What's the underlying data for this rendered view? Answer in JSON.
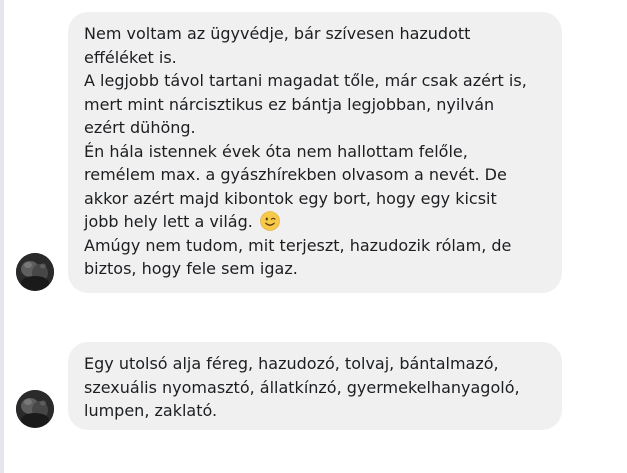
{
  "messages": [
    {
      "lines": [
        "Nem voltam az ügyvédje, bár szívesen hazudott",
        "efféléket is.",
        "A legjobb távol tartani magadat tőle, már csak azért is,",
        "mert mint nárcisztikus ez bántja legjobban, nyilván",
        "ezért dühöng.",
        "Én hála istennek évek óta nem hallottam felőle,",
        "remélem max. a gyászhírekben olvasom a nevét. De",
        "akkor azért majd kibontok egy bort, hogy egy kicsit",
        "jobb hely lett a világ.",
        "Amúgy nem tudom, mit terjeszt, hazudozik rólam, de",
        "biztos, hogy fele sem igaz."
      ],
      "emoji_after_line": 8,
      "emoji_icon": "wink-emoji-icon"
    },
    {
      "lines": [
        "Egy utolsó alja féreg, hazudozó, tolvaj, bántalmazó,",
        "szexuális nyomasztó, állatkínzó, gyermekelhanyagoló,",
        "lumpen, zaklató."
      ]
    }
  ],
  "colors": {
    "bubble_bg": "#f0f0f0",
    "text": "#1c1e21",
    "emoji_face": "#f7c948"
  }
}
